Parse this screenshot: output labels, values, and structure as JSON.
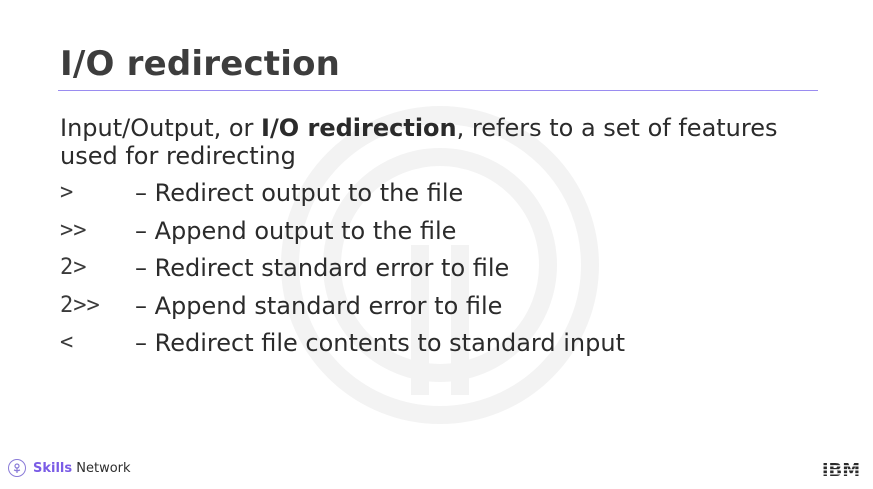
{
  "slide": {
    "title": "I/O redirection",
    "intro": {
      "before": "Input/Output, or ",
      "bold": "I/O redirection",
      "after": ", refers to a set of features used for redirecting"
    },
    "rows": [
      {
        "operator": ">",
        "description": "– Redirect output to the file"
      },
      {
        "operator": ">>",
        "description": "– Append output to the file"
      },
      {
        "operator": "2>",
        "description": "– Redirect standard error to file"
      },
      {
        "operator": "2>>",
        "description": "– Append standard error to file"
      },
      {
        "operator": "<",
        "description": "– Redirect file contents to standard input"
      }
    ]
  },
  "footer": {
    "brand_strong": "Skills",
    "brand_rest": " Network",
    "ibm_logo": "IBM"
  },
  "colors": {
    "title": "#3d3d3d",
    "rule": "#9a8cf0",
    "brand_accent": "#7a5ce6"
  },
  "icons": [
    "skills-network-logo-icon",
    "ibm-logo-icon",
    "watermark-icon"
  ]
}
